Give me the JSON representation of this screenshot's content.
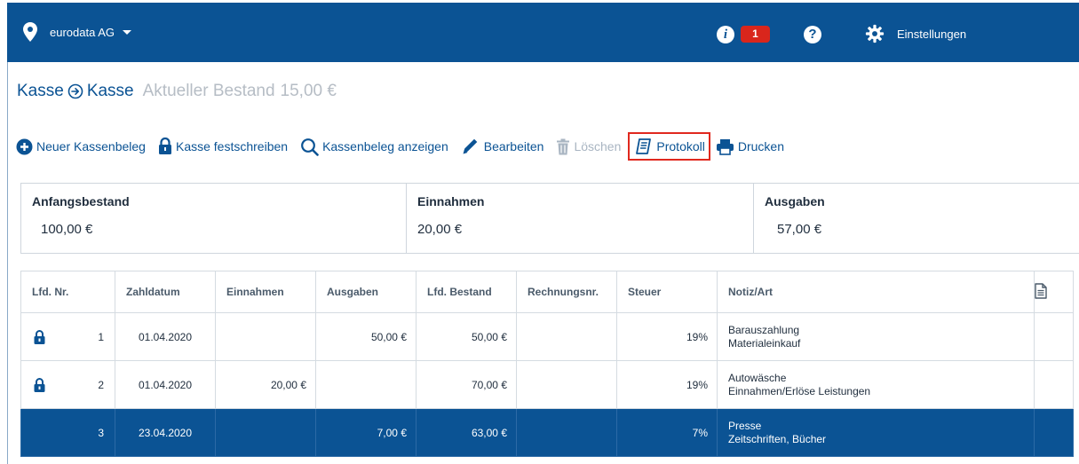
{
  "header": {
    "company": "eurodata AG",
    "notification_count": "1",
    "info_icon": "info-icon",
    "help_icon": "help-icon",
    "settings_label": "Einstellungen"
  },
  "breadcrumb": {
    "first": "Kasse",
    "second": "Kasse",
    "balance_label": "Aktueller Bestand",
    "balance_value": "15,00 €"
  },
  "toolbar": {
    "new_receipt": "Neuer Kassenbeleg",
    "lock_cash": "Kasse festschreiben",
    "show_receipt": "Kassenbeleg anzeigen",
    "edit": "Bearbeiten",
    "delete": "Löschen",
    "protocol": "Protokoll",
    "print": "Drucken"
  },
  "summary": {
    "opening_label": "Anfangsbestand",
    "opening_value": "100,00 €",
    "income_label": "Einnahmen",
    "income_value": "20,00 €",
    "expenses_label": "Ausgaben",
    "expenses_value": "57,00 €"
  },
  "table": {
    "headers": [
      "Lfd. Nr.",
      "Zahldatum",
      "Einnahmen",
      "Ausgaben",
      "Lfd. Bestand",
      "Rechnungsnr.",
      "Steuer",
      "Notiz/Art"
    ],
    "rows": [
      {
        "nr": "1",
        "date": "01.04.2020",
        "income": "",
        "expense": "50,00 €",
        "balance": "50,00 €",
        "invoice": "",
        "tax": "19%",
        "note1": "Barauszahlung",
        "note2": "Materialeinkauf",
        "locked": true
      },
      {
        "nr": "2",
        "date": "01.04.2020",
        "income": "20,00 €",
        "expense": "",
        "balance": "70,00 €",
        "invoice": "",
        "tax": "19%",
        "note1": "Autowäsche",
        "note2": "Einnahmen/Erlöse Leistungen",
        "locked": true
      },
      {
        "nr": "3",
        "date": "23.04.2020",
        "income": "",
        "expense": "7,00 €",
        "balance": "63,00 €",
        "invoice": "",
        "tax": "7%",
        "note1": "Presse",
        "note2": "Zeitschriften, Bücher",
        "locked": false
      }
    ]
  },
  "colors": {
    "brand_blue": "#0b5394",
    "badge_red": "#d9261c",
    "highlight_outline": "#e0281e"
  }
}
